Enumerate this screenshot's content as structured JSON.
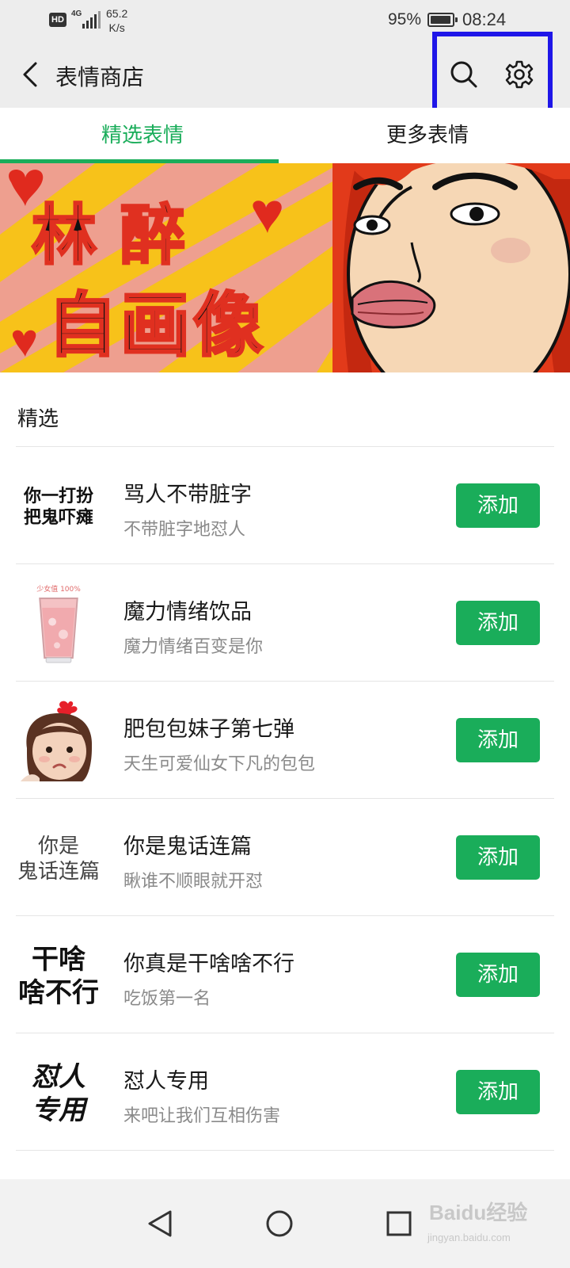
{
  "status_bar": {
    "hd": "HD",
    "network": "4G",
    "speed_value": "65.2",
    "speed_unit": "K/s",
    "battery_percent": "95%",
    "battery_level": 0.95,
    "time": "08:24"
  },
  "header": {
    "title": "表情商店",
    "icons": [
      "back-arrow-icon",
      "search-icon",
      "gear-icon"
    ]
  },
  "tabs": [
    {
      "label": "精选表情",
      "active": true
    },
    {
      "label": "更多表情",
      "active": false
    }
  ],
  "banner": {
    "line1": "林醉",
    "line2": "自画像"
  },
  "section": {
    "title": "精选"
  },
  "stickers": [
    {
      "title": "骂人不带脏字",
      "subtitle": "不带脏字地怼人",
      "button": "添加",
      "thumb_text": "你一打扮\n把鬼吓瘫"
    },
    {
      "title": "魔力情绪饮品",
      "subtitle": "魔力情绪百变是你",
      "button": "添加",
      "thumb_text": "少女值 100%"
    },
    {
      "title": "肥包包妹子第七弹",
      "subtitle": "天生可爱仙女下凡的包包",
      "button": "添加",
      "thumb_text": ""
    },
    {
      "title": "你是鬼话连篇",
      "subtitle": "瞅谁不顺眼就开怼",
      "button": "添加",
      "thumb_text": "你是\n鬼话连篇"
    },
    {
      "title": "你真是干啥啥不行",
      "subtitle": "吃饭第一名",
      "button": "添加",
      "thumb_text": "干啥\n啥不行"
    },
    {
      "title": "怼人专用",
      "subtitle": "来吧让我们互相伤害",
      "button": "添加",
      "thumb_text": "怼人\n专用"
    }
  ],
  "nav_bar": {
    "icons": [
      "back-triangle-icon",
      "home-circle-icon",
      "recents-square-icon"
    ]
  },
  "watermark": {
    "brand": "Baidu经验",
    "url": "jingyan.baidu.com"
  },
  "colors": {
    "accent": "#1aad5a",
    "highlight": "#1f16e8",
    "bar_bg": "#ededed"
  }
}
